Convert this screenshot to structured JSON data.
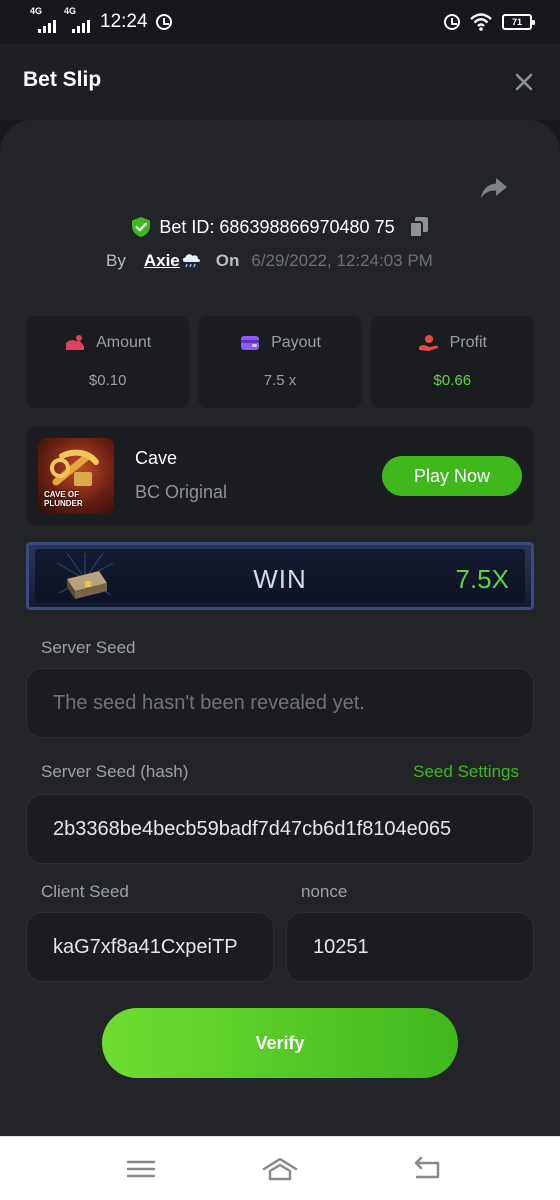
{
  "status_bar": {
    "network_1": "4G",
    "network_2": "4G",
    "time": "12:24",
    "battery": "71"
  },
  "header": {
    "title": "Bet Slip"
  },
  "bet": {
    "id_label": "Bet ID: 686398866970480 75",
    "by_label": "By",
    "user": "Axie",
    "on_label": "On",
    "date": "6/29/2022, 12:24:03 PM"
  },
  "stats": [
    {
      "label": "Amount",
      "value": "$0.10",
      "color": "#e0405a"
    },
    {
      "label": "Payout",
      "value": "7.5 x",
      "color": "#8b5cf6"
    },
    {
      "label": "Profit",
      "value": "$0.66",
      "color": "#e84a3c"
    }
  ],
  "game": {
    "thumb_text_1": "CAVE OF",
    "thumb_text_2": "PLUNDER",
    "name": "Cave",
    "subtitle": "BC Original",
    "play_label": "Play Now"
  },
  "result": {
    "label": "WIN",
    "multiplier": "7.5X"
  },
  "seeds": {
    "server_seed_label": "Server Seed",
    "server_seed_placeholder": "The seed hasn't been revealed yet.",
    "hash_label": "Server Seed (hash)",
    "seed_settings_label": "Seed Settings",
    "hash_value": "2b3368be4becb59badf7d47cb6d1f8104e065",
    "client_seed_label": "Client Seed",
    "client_seed_value": "kaG7xf8a41CxpeiTP",
    "nonce_label": "nonce",
    "nonce_value": "10251"
  },
  "verify_label": "Verify",
  "colors": {
    "accent_green": "#3fb81c",
    "background": "#17181b",
    "card": "#232427"
  }
}
